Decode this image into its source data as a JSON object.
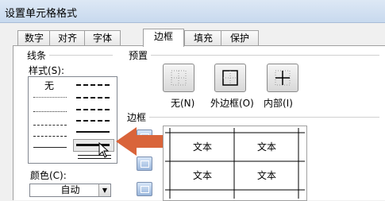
{
  "window": {
    "title": "设置单元格格式"
  },
  "tabs": [
    {
      "label": "数字"
    },
    {
      "label": "对齐"
    },
    {
      "label": "字体"
    },
    {
      "label": "边框",
      "active": true
    },
    {
      "label": "填充"
    },
    {
      "label": "保护"
    }
  ],
  "line": {
    "group_label": "线条",
    "style_label": "样式(S):",
    "none_label": "无",
    "color_label": "颜色(C):",
    "color_value": "自动"
  },
  "presets": {
    "group_label": "预置",
    "items": [
      {
        "label": "无(N)",
        "icon": "no-border-icon"
      },
      {
        "label": "外边框(O)",
        "icon": "outline-border-icon"
      },
      {
        "label": "内部(I)",
        "icon": "inside-border-icon"
      }
    ]
  },
  "border": {
    "group_label": "边框",
    "preview_cells": [
      "文本",
      "文本",
      "文本",
      "文本"
    ]
  },
  "annotation": {
    "arrow_color": "#d9643a"
  },
  "colors": {
    "accent_blue": "#9ab6dc",
    "tab_border": "#a0a0a0"
  }
}
